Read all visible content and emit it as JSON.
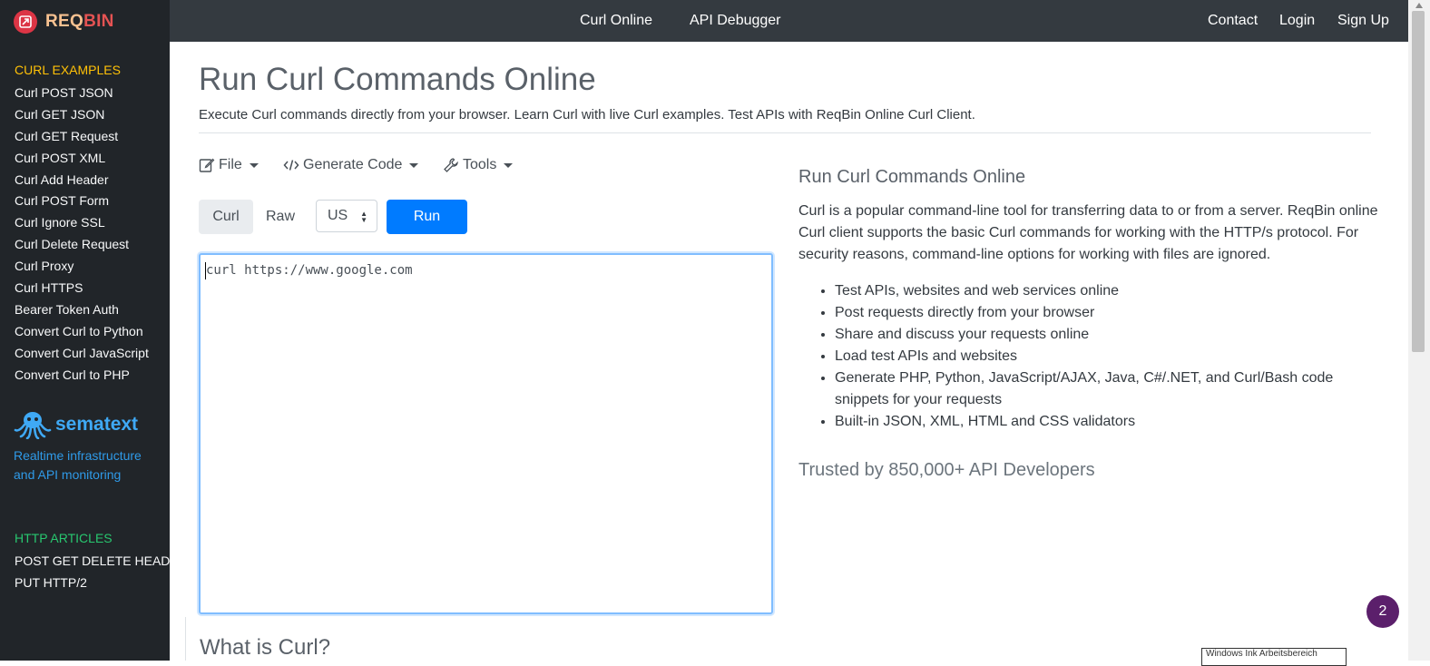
{
  "brand": {
    "part1": "REQ",
    "part2": "BIN"
  },
  "nav": {
    "curl_online": "Curl Online",
    "api_debugger": "API Debugger",
    "contact": "Contact",
    "login": "Login",
    "signup": "Sign Up"
  },
  "sidebar": {
    "curl_heading": "CURL EXAMPLES",
    "curl_items": [
      "Curl POST JSON",
      "Curl GET JSON",
      "Curl GET Request",
      "Curl POST XML",
      "Curl Add Header",
      "Curl POST Form",
      "Curl Ignore SSL",
      "Curl Delete Request",
      "Curl Proxy",
      "Curl HTTPS",
      "Bearer Token Auth",
      "Convert Curl to Python",
      "Convert Curl JavaScript",
      "Convert Curl to PHP"
    ],
    "sponsor_name": "sematext",
    "sponsor_text": "Realtime infrastructure and API monitoring",
    "http_heading": "HTTP ARTICLES",
    "http_items": [
      "POST GET DELETE HEAD",
      "PUT HTTP/2"
    ]
  },
  "main": {
    "title": "Run Curl Commands Online",
    "subtitle": "Execute Curl commands directly from your browser. Learn Curl with live Curl examples. Test APIs with ReqBin Online Curl Client.",
    "toolbar": {
      "file": "File",
      "generate_code": "Generate Code",
      "tools": "Tools"
    },
    "tabs": {
      "curl": "Curl",
      "raw": "Raw"
    },
    "region": "US",
    "run_label": "Run",
    "editor_value": "curl https://www.google.com",
    "what_is": "What is Curl?"
  },
  "info": {
    "title": "Run Curl Commands Online",
    "description": "Curl is a popular command-line tool for transferring data to or from a server. ReqBin online Curl client supports the basic Curl commands for working with the HTTP/s protocol. For security reasons, command-line options for working with files are ignored.",
    "features": [
      "Test APIs, websites and web services online",
      "Post requests directly from your browser",
      "Share and discuss your requests online",
      "Load test APIs and websites",
      "Generate PHP, Python, JavaScript/AJAX, Java, C#/.NET, and Curl/Bash code snippets for your requests",
      "Built-in JSON, XML, HTML and CSS validators"
    ],
    "trusted": "Trusted by 850,000+ API Developers"
  },
  "overlay": {
    "windows_box": "Windows Ink Arbeitsbereich"
  },
  "notification_count": "2",
  "colors": {
    "sidebar_bg": "#212529",
    "topnav_bg": "#343a40",
    "run_button": "#007bff",
    "curl_heading": "#ffc107",
    "http_heading": "#28c76f",
    "brand_bin": "#e55353",
    "sponsor": "#3fa9f5",
    "badge": "#5b1f6b"
  },
  "icons": {
    "brand": "reqbin-logo-icon",
    "file": "edit-file-icon",
    "code": "code-icon",
    "tools": "wrench-icon",
    "sponsor": "octopus-icon"
  }
}
